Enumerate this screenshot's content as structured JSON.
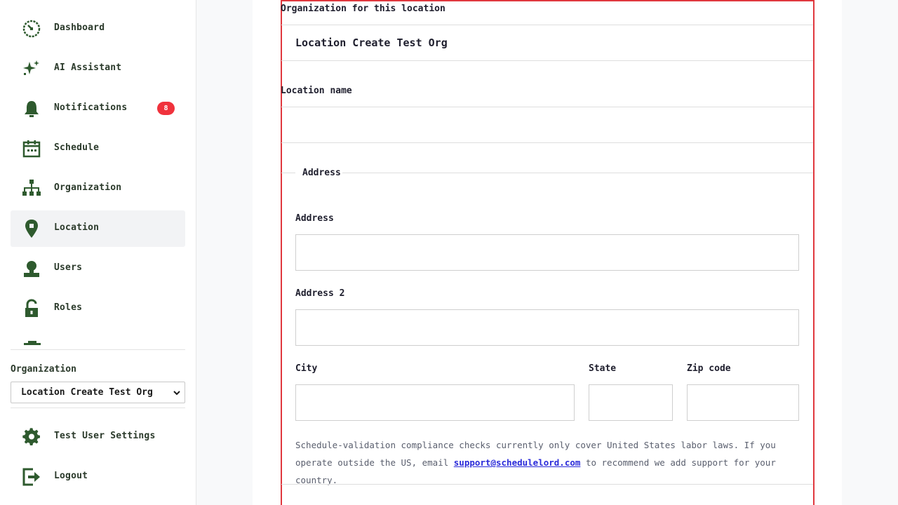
{
  "sidebar": {
    "items": [
      {
        "label": "Dashboard",
        "icon": "dashboard-icon"
      },
      {
        "label": "AI Assistant",
        "icon": "sparkle-icon"
      },
      {
        "label": "Notifications",
        "icon": "bell-icon",
        "badge": "8"
      },
      {
        "label": "Schedule",
        "icon": "calendar-icon"
      },
      {
        "label": "Organization",
        "icon": "org-chart-icon"
      },
      {
        "label": "Location",
        "icon": "map-pin-icon",
        "active": true
      },
      {
        "label": "Users",
        "icon": "user-icon"
      },
      {
        "label": "Roles",
        "icon": "unlock-icon"
      }
    ],
    "organization_label": "Organization",
    "organization_selected": "Location Create Test Org",
    "settings_label": "Test User Settings",
    "logout_label": "Logout"
  },
  "form": {
    "org_label": "Organization for this location",
    "org_value": "Location Create Test Org",
    "location_name_label": "Location name",
    "location_name_value": "",
    "address_legend": "Address",
    "address_label": "Address",
    "address_value": "",
    "address2_label": "Address 2",
    "address2_value": "",
    "city_label": "City",
    "state_label": "State",
    "zip_label": "Zip code",
    "note_part1": "Schedule-validation compliance checks currently only cover United States labor laws. If you operate outside the US, email",
    "note_email": "support@schedulelord.com",
    "note_part2": "to recommend we add support for your country."
  },
  "colors": {
    "accent_green": "#2e5a2e",
    "badge_red": "#f0323c",
    "outline_red": "#e0383e",
    "link_blue": "#2b2bd9"
  }
}
